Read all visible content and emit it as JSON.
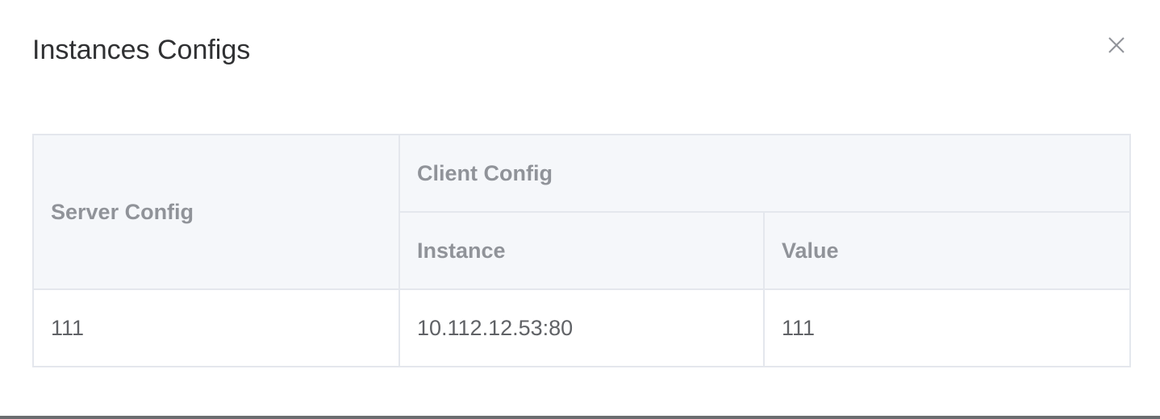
{
  "dialog": {
    "title": "Instances Configs",
    "close_icon": "close-icon"
  },
  "table": {
    "headers": {
      "server_config": "Server Config",
      "client_config": "Client Config",
      "instance": "Instance",
      "value": "Value"
    },
    "rows": [
      {
        "server_config": "111",
        "instance": "10.112.12.53:80",
        "value": "111"
      }
    ]
  },
  "colors": {
    "header_bg": "#f5f7fa",
    "border": "#e4e7ed",
    "header_text": "#909399",
    "cell_text": "#606266",
    "title_text": "#303133"
  }
}
